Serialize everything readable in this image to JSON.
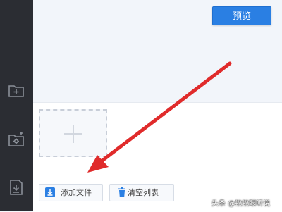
{
  "toolbar": {
    "preview_label": "预览"
  },
  "upload": {
    "add_file_label": "添加文件",
    "clear_list_label": "清空列表"
  },
  "sidebar": {
    "items": [
      {
        "icon": "folder-add-icon"
      },
      {
        "icon": "folder-settings-icon"
      },
      {
        "icon": "download-file-icon"
      }
    ]
  },
  "overlay": {
    "arrow_color": "#e02b2b"
  },
  "watermark": {
    "text": "头条 @蚊蚊眼听说"
  },
  "colors": {
    "accent": "#2a7fe3",
    "sidebar": "#2b2d33"
  }
}
